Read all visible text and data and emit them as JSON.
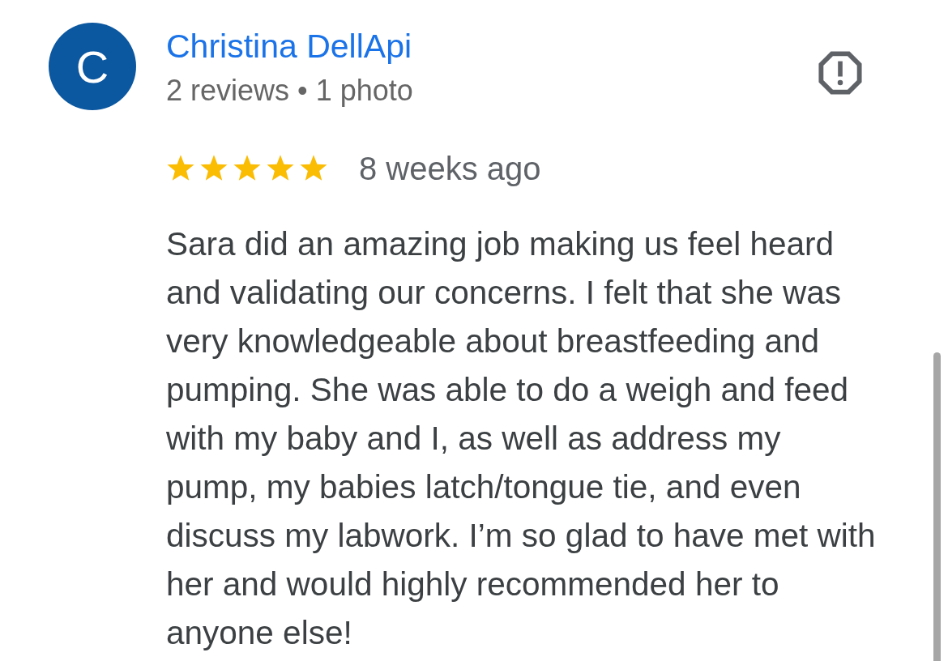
{
  "reviewer": {
    "initial": "C",
    "name": "Christina DellApi",
    "stats": "2 reviews • 1 photo"
  },
  "review": {
    "stars": 5,
    "time": "8 weeks ago",
    "text": "Sara did an amazing job making us feel heard and validating our concerns. I felt that she was very knowledgeable about breastfeeding and pumping. She was able to do a weigh and feed with my baby and I, as well as address my pump, my babies latch/tongue tie, and even discuss my labwork. I’m so glad to have met with her and would highly recommended her to anyone else!"
  }
}
